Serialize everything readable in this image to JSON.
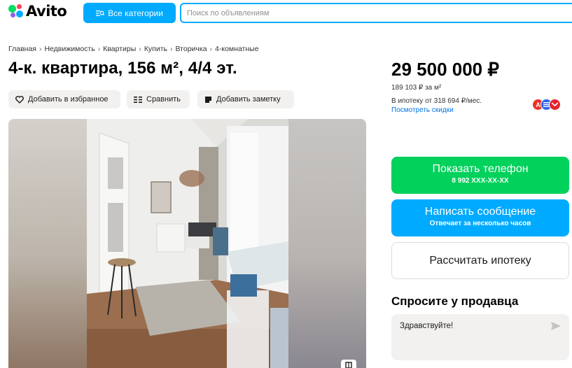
{
  "header": {
    "logo": "Avito",
    "categories_button": "Все категории",
    "search_placeholder": "Поиск по объявлениям"
  },
  "breadcrumbs": [
    "Главная",
    "Недвижимость",
    "Квартиры",
    "Купить",
    "Вторичка",
    "4-комнатные"
  ],
  "breadcrumb_separator": "›",
  "title": "4-к. квартира, 156 м², 4/4 эт.",
  "actions": {
    "favorite": "Добавить в избранное",
    "compare": "Сравнить",
    "note": "Добавить заметку"
  },
  "price": {
    "total": "29 500 000 ₽",
    "per_meter": "189 103 ₽ за м²",
    "mortgage": "В ипотеку от 318 694 ₽/мес.",
    "discounts_link": "Посмотреть скидки"
  },
  "banks": [
    {
      "icon": "alfa-bank-icon",
      "letter": "А",
      "color": "#ef3124"
    },
    {
      "icon": "bank-icon",
      "letter": "",
      "color": "#2b61ec"
    },
    {
      "icon": "bank-icon",
      "letter": "",
      "color": "#e4232e"
    }
  ],
  "buttons": {
    "show_phone": "Показать телефон",
    "phone_masked": "8 992 XXX-XX-XX",
    "write_message": "Написать сообщение",
    "reply_time": "Отвечает за несколько часов",
    "mortgage_calc": "Рассчитать ипотеку"
  },
  "ask_seller": {
    "title": "Спросите у продавца",
    "message": "Здравствуйте!"
  },
  "colors": {
    "accent_blue": "#00aaff",
    "accent_green": "#02d15c",
    "link": "#0073e6"
  }
}
